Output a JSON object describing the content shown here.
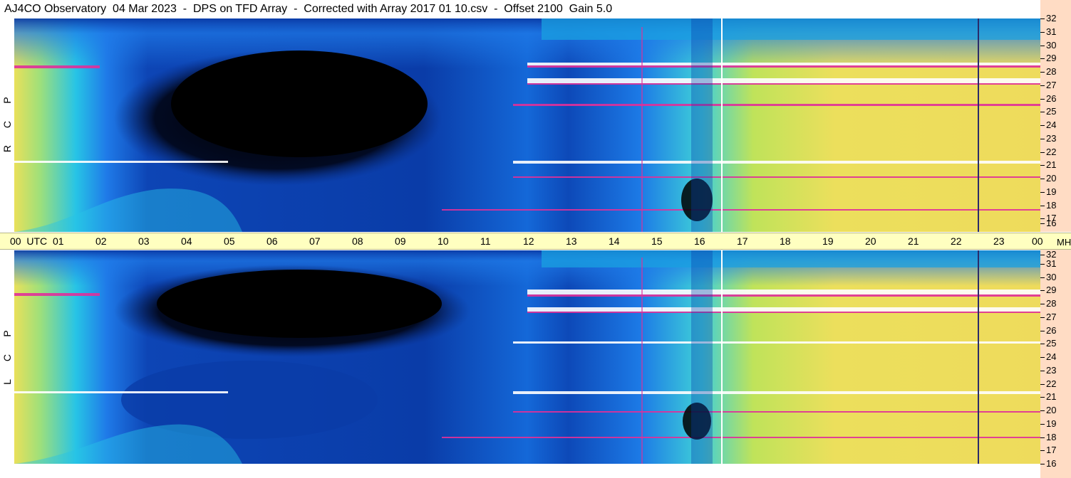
{
  "title": "AJ4CO Observatory  04 Mar 2023  -  DPS on TFD Array  -  Corrected with Array 2017 01 10.csv  -  Offset 2100  Gain 5.0",
  "panels": [
    {
      "id": "rcp",
      "label": [
        "R",
        "C",
        "P"
      ]
    },
    {
      "id": "lcp",
      "label": [
        "L",
        "C",
        "P"
      ]
    }
  ],
  "time_axis": {
    "labels": [
      "00  UTC",
      "01",
      "02",
      "03",
      "04",
      "05",
      "06",
      "07",
      "08",
      "09",
      "10",
      "11",
      "12",
      "13",
      "14",
      "15",
      "16",
      "17",
      "18",
      "19",
      "20",
      "21",
      "22",
      "23",
      "00"
    ],
    "unit_label": "MHz"
  },
  "freq_axis": {
    "labels": [
      "32",
      "31",
      "30",
      "29",
      "28",
      "27",
      "26",
      "25",
      "24",
      "23",
      "22",
      "21",
      "20",
      "19",
      "18",
      "17",
      "16"
    ]
  },
  "colors": {
    "background_dark": "#000000",
    "deep_blue": "#0a3ca8",
    "blue": "#1f7ae8",
    "cyan": "#26c3e8",
    "green_yellow": "#b9e35a",
    "yellow": "#efe15a",
    "orange": "#f2b25a",
    "magenta": "#e0309a",
    "white": "#ffffff",
    "axis_band": "#ffffc0",
    "freq_scale_band": "#ffdcc4"
  },
  "chart_data": {
    "type": "heatmap",
    "title": "AJ4CO Observatory  04 Mar 2023  -  DPS on TFD Array  -  Corrected with Array 2017 01 10.csv  -  Offset 2100  Gain 5.0",
    "xlabel": "UTC",
    "ylabel": "MHz",
    "x_range_hours": [
      0,
      24
    ],
    "y_range_mhz": [
      16,
      32
    ],
    "x_ticks": [
      "00",
      "01",
      "02",
      "03",
      "04",
      "05",
      "06",
      "07",
      "08",
      "09",
      "10",
      "11",
      "12",
      "13",
      "14",
      "15",
      "16",
      "17",
      "18",
      "19",
      "20",
      "21",
      "22",
      "23",
      "00"
    ],
    "y_ticks": [
      32,
      31,
      30,
      29,
      28,
      27,
      26,
      25,
      24,
      23,
      22,
      21,
      20,
      19,
      18,
      17,
      16
    ],
    "series": [
      {
        "name": "RCP",
        "night_void_hours": [
          2,
          10
        ],
        "vertical_markers_hours": [
          14.7,
          16.5,
          22.5
        ],
        "rfi_bands_mhz": [
          28.3,
          27.1,
          25.3,
          21.3,
          18.0
        ]
      },
      {
        "name": "LCP",
        "night_void_hours": [
          2,
          10
        ],
        "vertical_markers_hours": [
          14.7,
          16.5,
          22.5
        ],
        "rfi_bands_mhz": [
          28.9,
          27.6,
          25.2,
          21.4,
          18.0
        ]
      }
    ]
  }
}
